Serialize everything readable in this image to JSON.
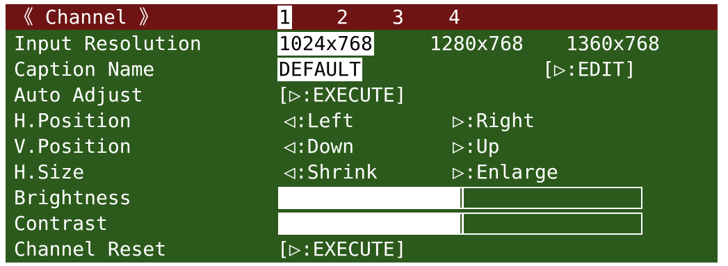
{
  "colors": {
    "panel_bg": "#2c5a1c",
    "header_bg": "#6e1414",
    "text": "#ffffff"
  },
  "header": {
    "title": "《 Channel 》",
    "channels": [
      "1",
      "2",
      "3",
      "4"
    ],
    "selected_channel": "1"
  },
  "rows": {
    "input_resolution": {
      "label": "Input Resolution",
      "options": [
        "1024x768",
        "1280x768",
        "1360x768"
      ],
      "selected": "1024x768"
    },
    "caption_name": {
      "label": "Caption Name",
      "value": "DEFAULT",
      "action": "[▷:EDIT]"
    },
    "auto_adjust": {
      "label": "Auto Adjust",
      "action": "[▷:EXECUTE]"
    },
    "h_position": {
      "label": "H.Position",
      "left": "◁:Left",
      "right": "▷:Right"
    },
    "v_position": {
      "label": "V.Position",
      "left": "◁:Down",
      "right": "▷:Up"
    },
    "h_size": {
      "label": "H.Size",
      "left": "◁:Shrink",
      "right": "▷:Enlarge"
    },
    "brightness": {
      "label": "Brightness",
      "level": 0.5
    },
    "contrast": {
      "label": "Contrast",
      "level": 0.5
    },
    "channel_reset": {
      "label": "Channel Reset",
      "action": "[▷:EXECUTE]"
    }
  }
}
